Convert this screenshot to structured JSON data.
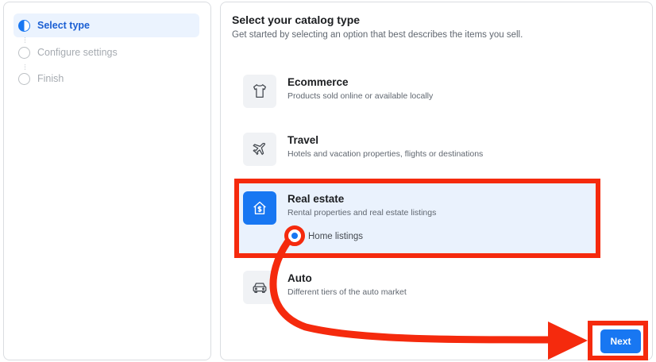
{
  "steps": [
    {
      "label": "Select type",
      "state": "active"
    },
    {
      "label": "Configure settings",
      "state": "inactive"
    },
    {
      "label": "Finish",
      "state": "inactive"
    }
  ],
  "main": {
    "title": "Select your catalog type",
    "subtitle": "Get started by selecting an option that best describes the items you sell.",
    "options": [
      {
        "title": "Ecommerce",
        "description": "Products sold online or available locally",
        "icon": "tshirt-icon"
      },
      {
        "title": "Travel",
        "description": "Hotels and vacation properties, flights or destinations",
        "icon": "airplane-icon"
      },
      {
        "title": "Real estate",
        "description": "Rental properties and real estate listings",
        "icon": "house-dollar-icon",
        "selected": true,
        "sub_option": {
          "label": "Home listings",
          "selected": true
        }
      },
      {
        "title": "Auto",
        "description": "Different tiers of the auto market",
        "icon": "car-icon"
      }
    ]
  },
  "footer": {
    "next_label": "Next"
  },
  "colors": {
    "accent": "#1877f2",
    "annotation": "#f52a0d",
    "selected_bg": "#eaf2fd"
  }
}
